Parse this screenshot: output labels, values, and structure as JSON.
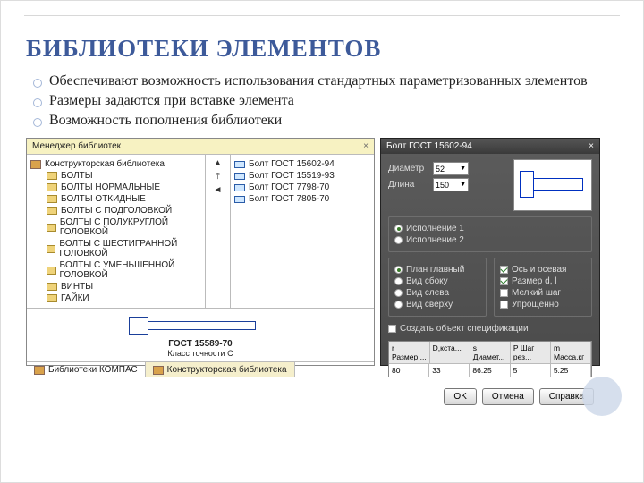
{
  "title": "БИБЛИОТЕКИ ЭЛЕМЕНТОВ",
  "bullets": [
    "Обеспечивают возможность использования стандартных параметризованных элементов",
    "Размеры задаются  при вставке элемента",
    "Возможность пополнения библиотеки"
  ],
  "libmgr": {
    "title": "Менеджер библиотек",
    "close": "×",
    "root": "Конструкторская библиотека",
    "folders": [
      "БОЛТЫ",
      "БОЛТЫ НОРМАЛЬНЫЕ",
      "БОЛТЫ ОТКИДНЫЕ",
      "БОЛТЫ С ПОДГОЛОВКОЙ",
      "БОЛТЫ С ПОЛУКРУГЛОЙ ГОЛОВКОЙ",
      "БОЛТЫ С ШЕСТИГРАННОЙ ГОЛОВКОЙ",
      "БОЛТЫ С УМЕНЬШЕННОЙ ГОЛОВКОЙ",
      "ВИНТЫ",
      "ГАЙКИ"
    ],
    "items": [
      "Болт ГОСТ 15602-94",
      "Болт ГОСТ 15519-93",
      "Болт ГОСТ 7798-70",
      "Болт ГОСТ 7805-70"
    ],
    "preview_caption": "ГОСТ 15589-70",
    "preview_sub": "Класс точности С",
    "tabs": [
      "Библиотеки КОМПАС",
      "Конструкторская библиотека"
    ]
  },
  "dialog": {
    "title": "Болт ГОСТ 15602-94",
    "close": "×",
    "diameter_label": "Диаметр",
    "diameter_value": "52",
    "length_label": "Длина",
    "length_value": "150",
    "exec": {
      "opt1": "Исполнение 1",
      "opt2": "Исполнение 2"
    },
    "views": {
      "plan": "План главный",
      "side": "Вид сбоку",
      "left": "Вид слева",
      "top": "Вид сверху"
    },
    "opts": {
      "axis": "Ось и осевая",
      "dim": "Размер d, l",
      "small": "Мелкий шаг",
      "simpl": "Упрощённо"
    },
    "spec_ck": "Создать объект спецификации",
    "table": {
      "headers": [
        "r Размер,...",
        "D,кста...",
        "s Диамет...",
        "P Шаг рез...",
        "m Масса,кг"
      ],
      "row": [
        "80",
        "33",
        "86.25",
        "5",
        "5.25"
      ]
    },
    "ok": "OK",
    "cancel": "Отмена",
    "help": "Справка"
  }
}
